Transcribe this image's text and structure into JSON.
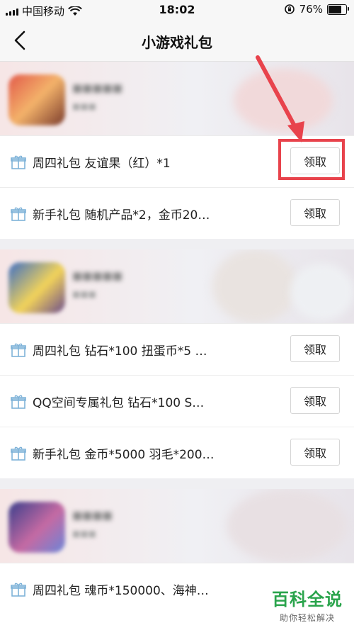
{
  "status_bar": {
    "carrier": "中国移动",
    "time": "18:02",
    "battery": "76%",
    "battery_level": 0.76
  },
  "nav": {
    "title": "小游戏礼包",
    "back_icon": "chevron-left-icon"
  },
  "groups": [
    {
      "gifts": [
        {
          "text": "周四礼包 友谊果（红）*1",
          "button": "领取"
        },
        {
          "text": "新手礼包 随机产品*2，金币20…",
          "button": "领取"
        }
      ]
    },
    {
      "gifts": [
        {
          "text": "周四礼包 钻石*100 扭蛋币*5 …",
          "button": "领取"
        },
        {
          "text": "QQ空间专属礼包 钻石*100 S…",
          "button": "领取"
        },
        {
          "text": "新手礼包 金币*5000 羽毛*200…",
          "button": "领取"
        }
      ]
    },
    {
      "gifts": [
        {
          "text": "周四礼包 魂币*150000、海神…",
          "button": "领取"
        }
      ]
    }
  ],
  "watermark": {
    "line1": "百科全说",
    "line2": "助你轻松解决"
  },
  "colors": {
    "highlight": "#e8434c",
    "watermark": "#2aa44c",
    "gift_icon": "#7fb3d9"
  }
}
